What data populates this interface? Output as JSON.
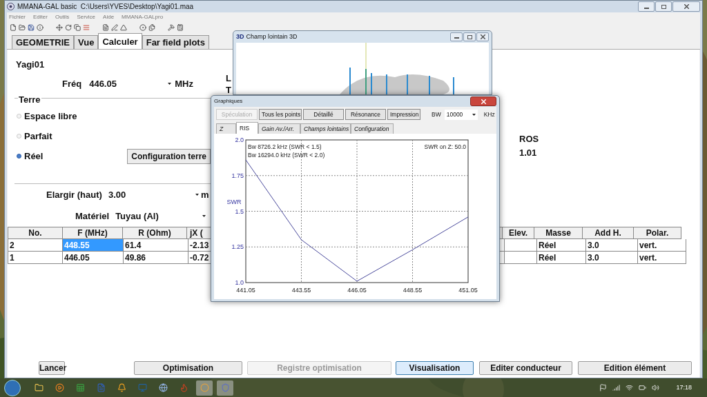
{
  "window": {
    "title": "MMANA-GAL basic  C:\\Users\\YVES\\Desktop\\Yagi01.maa"
  },
  "menu": [
    "Fichier",
    "Editer",
    "Outils",
    "Service",
    "Aide",
    "MMANA-GALpro"
  ],
  "tabs": [
    {
      "label": "GEOMETRIE",
      "selected": false
    },
    {
      "label": "Vue",
      "selected": false
    },
    {
      "label": "Calculer",
      "selected": true
    },
    {
      "label": "Far field plots",
      "selected": false
    }
  ],
  "antenna_name": "Yagi01",
  "frequency": {
    "label": "Fréq",
    "value": "446.05",
    "unit": "MHz"
  },
  "ground": {
    "title": "Terre",
    "options": [
      {
        "label": "Espace libre",
        "selected": false
      },
      {
        "label": "Parfait",
        "selected": false
      },
      {
        "label": "Réel",
        "selected": true
      }
    ],
    "config_button": "Configuration terre"
  },
  "expand": {
    "label": "Elargir (haut)",
    "value": "3.00",
    "unit": "m"
  },
  "material": {
    "label": "Matériel",
    "value": "Tuyau (Al)"
  },
  "result_labels": [
    "L",
    "T"
  ],
  "ros": {
    "label": "ROS",
    "value": "1.01"
  },
  "table": {
    "columns": [
      "No.",
      "F (MHz)",
      "R (Ohm)",
      "jX (",
      "Elev.",
      "Masse",
      "Add H.",
      "Polar."
    ],
    "rows": [
      {
        "no": "2",
        "f": "448.55",
        "r": "61.4",
        "jx": "-2.13",
        "masse": "Réel",
        "add_h": "3.0",
        "polar": "vert.",
        "selected": true
      },
      {
        "no": "1",
        "f": "446.05",
        "r": "49.86",
        "jx": "-0.72",
        "masse": "Réel",
        "add_h": "3.0",
        "polar": "vert.",
        "selected": false
      }
    ]
  },
  "buttons": [
    {
      "label": "Lancer",
      "disabled": false,
      "focused": false
    },
    {
      "label": "Optimisation",
      "disabled": false,
      "focused": false
    },
    {
      "label": "Registre optimisation",
      "disabled": true,
      "focused": false
    },
    {
      "label": "Visualisation",
      "disabled": false,
      "focused": true
    },
    {
      "label": "Editer conducteur",
      "disabled": false,
      "focused": false
    },
    {
      "label": "Edition élément",
      "disabled": false,
      "focused": false
    }
  ],
  "far_field_window": {
    "icon": "3D",
    "title": "Champ lointain 3D"
  },
  "graph_window": {
    "title": "Graphiques",
    "buttons": [
      {
        "label": "Spéculation",
        "disabled": true
      },
      {
        "label": "Tous les points",
        "disabled": false
      },
      {
        "label": "Détaillé",
        "disabled": false
      },
      {
        "label": "Résonance",
        "disabled": false
      },
      {
        "label": "Impression",
        "disabled": false
      }
    ],
    "bw": {
      "label": "BW",
      "value": "10000",
      "unit": "KHz"
    },
    "tabs": [
      {
        "label": "Z",
        "selected": false
      },
      {
        "label": "RIS",
        "selected": true
      },
      {
        "label": "Gain Av./Arr.",
        "selected": false
      },
      {
        "label": "Champs lointains",
        "selected": false
      },
      {
        "label": "Configuration",
        "selected": false
      }
    ],
    "chart_data": {
      "type": "line",
      "ylabel": "SWR",
      "x": [
        441.05,
        443.55,
        446.05,
        448.55,
        451.05
      ],
      "series": [
        {
          "color": "#4a4a9c",
          "values": [
            1.86,
            1.3,
            1.01,
            1.23,
            1.46
          ]
        }
      ],
      "grid": true,
      "xlim": [
        441.05,
        451.05
      ],
      "ylim": [
        1.0,
        2.0
      ],
      "xticks": [
        {
          "value": 441.05,
          "label": "441.05"
        },
        {
          "value": 443.55,
          "label": "443.55"
        },
        {
          "value": 446.05,
          "label": "446.05"
        },
        {
          "value": 448.55,
          "label": "448.55"
        },
        {
          "value": 451.05,
          "label": "451.05"
        }
      ],
      "yticks": [
        {
          "value": 1.0,
          "label": "1.0"
        },
        {
          "value": 1.25,
          "label": "1.25"
        },
        {
          "value": 1.5,
          "label": "1.5"
        },
        {
          "value": 1.75,
          "label": "1.75"
        },
        {
          "value": 2.0,
          "label": "2.0"
        }
      ],
      "annotations": [
        "Bw 8726.2 kHz (SWR < 1.5)",
        "Bw 16294.0 kHz (SWR < 2.0)",
        "SWR on Z: 50.0"
      ]
    }
  },
  "taskbar": {
    "clock": "17:18"
  }
}
